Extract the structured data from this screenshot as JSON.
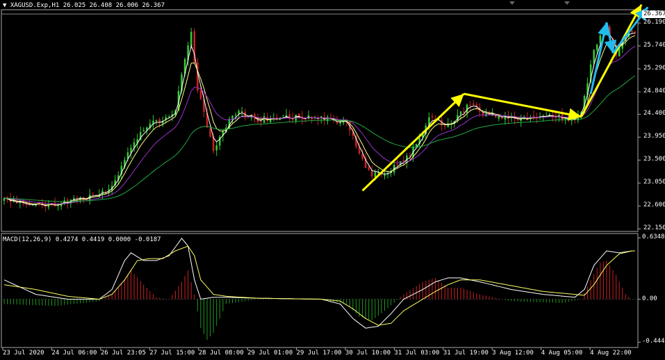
{
  "header": {
    "symbol_label": "XAGUSD.Exp,H1",
    "ohlc": "26.025 26.408 26.006 26.367",
    "macd_label": "MACD(12,26,9) 0.4274 0.4419 0.0000 -0.0187"
  },
  "colors": {
    "background": "#000000",
    "bull_candle": "#33cc33",
    "bear_candle": "#cc2222",
    "fast_ma": "#ffff88",
    "mid_ma": "#9932cc",
    "slow_ma": "#22aa44",
    "white_ma": "#ffffff",
    "annotation_yellow": "#ffff00",
    "annotation_cyan": "#22bbee",
    "hist_pos": "#cc2222",
    "hist_neg": "#229922",
    "macd_line": "#ffffff",
    "signal_line": "#ffff66",
    "axis": "#aaaaaa"
  },
  "chart_data": {
    "type": "candlestick",
    "price_axis": {
      "ticks": [
        "26.190",
        "25.740",
        "25.290",
        "24.840",
        "24.400",
        "23.950",
        "23.500",
        "23.050",
        "22.600",
        "22.150"
      ],
      "range": [
        22.1,
        26.45
      ],
      "current_price": "26.367"
    },
    "time_axis": {
      "ticks": [
        "23 Jul 2020",
        "24 Jul 06:00",
        "26 Jul 23:05",
        "27 Jul 15:00",
        "28 Jul 08:00",
        "29 Jul 01:00",
        "29 Jul 17:00",
        "30 Jul 10:00",
        "31 Jul 03:00",
        "31 Jul 19:00",
        "3 Aug 12:00",
        "4 Aug 05:00",
        "4 Aug 22:00"
      ]
    },
    "key_closes": [
      [
        0,
        22.72
      ],
      [
        14,
        22.62
      ],
      [
        24,
        22.72
      ],
      [
        34,
        22.95
      ],
      [
        40,
        23.8
      ],
      [
        46,
        24.25
      ],
      [
        50,
        24.25
      ],
      [
        54,
        24.5
      ],
      [
        57,
        25.5
      ],
      [
        59,
        26.0
      ],
      [
        61,
        24.9
      ],
      [
        63,
        24.4
      ],
      [
        66,
        23.7
      ],
      [
        68,
        23.95
      ],
      [
        71,
        24.3
      ],
      [
        74,
        24.45
      ],
      [
        80,
        24.3
      ],
      [
        90,
        24.35
      ],
      [
        100,
        24.3
      ],
      [
        108,
        24.25
      ],
      [
        112,
        23.6
      ],
      [
        116,
        23.2
      ],
      [
        120,
        23.25
      ],
      [
        124,
        23.4
      ],
      [
        128,
        23.6
      ],
      [
        134,
        24.3
      ],
      [
        140,
        24.2
      ],
      [
        144,
        24.4
      ],
      [
        147,
        24.6
      ],
      [
        150,
        24.45
      ],
      [
        160,
        24.3
      ],
      [
        170,
        24.35
      ],
      [
        180,
        24.3
      ],
      [
        182,
        24.4
      ],
      [
        185,
        25.4
      ],
      [
        188,
        26.0
      ],
      [
        190,
        26.1
      ],
      [
        193,
        25.6
      ],
      [
        196,
        26.0
      ],
      [
        198,
        26.05
      ]
    ],
    "macd": {
      "ticks": [
        "0.6348",
        "0.00",
        "-0.4449"
      ],
      "range": [
        -0.5,
        0.68
      ],
      "key_hist": [
        [
          0,
          -0.05
        ],
        [
          16,
          -0.07
        ],
        [
          30,
          -0.02
        ],
        [
          34,
          0.05
        ],
        [
          38,
          0.2
        ],
        [
          40,
          0.3
        ],
        [
          44,
          0.15
        ],
        [
          48,
          0.02
        ],
        [
          52,
          0.0
        ],
        [
          56,
          0.18
        ],
        [
          58,
          0.3
        ],
        [
          60,
          0.05
        ],
        [
          62,
          -0.3
        ],
        [
          64,
          -0.42
        ],
        [
          66,
          -0.35
        ],
        [
          70,
          -0.05
        ],
        [
          80,
          0.0
        ],
        [
          100,
          0.0
        ],
        [
          108,
          -0.05
        ],
        [
          112,
          -0.18
        ],
        [
          116,
          -0.22
        ],
        [
          120,
          -0.12
        ],
        [
          126,
          0.05
        ],
        [
          132,
          0.18
        ],
        [
          136,
          0.22
        ],
        [
          140,
          0.12
        ],
        [
          144,
          0.12
        ],
        [
          150,
          0.05
        ],
        [
          160,
          -0.02
        ],
        [
          176,
          -0.04
        ],
        [
          182,
          0.0
        ],
        [
          185,
          0.2
        ],
        [
          188,
          0.38
        ],
        [
          190,
          0.4
        ],
        [
          193,
          0.25
        ],
        [
          196,
          0.05
        ],
        [
          198,
          0.0
        ]
      ],
      "key_macd": [
        [
          0,
          0.2
        ],
        [
          10,
          0.05
        ],
        [
          20,
          0.0
        ],
        [
          30,
          0.0
        ],
        [
          34,
          0.1
        ],
        [
          38,
          0.4
        ],
        [
          40,
          0.48
        ],
        [
          44,
          0.4
        ],
        [
          48,
          0.4
        ],
        [
          52,
          0.45
        ],
        [
          56,
          0.63
        ],
        [
          58,
          0.55
        ],
        [
          60,
          0.2
        ],
        [
          62,
          0.0
        ],
        [
          66,
          0.02
        ],
        [
          70,
          0.02
        ],
        [
          80,
          0.01
        ],
        [
          100,
          0.0
        ],
        [
          106,
          -0.05
        ],
        [
          110,
          -0.2
        ],
        [
          114,
          -0.3
        ],
        [
          118,
          -0.28
        ],
        [
          122,
          -0.15
        ],
        [
          126,
          0.0
        ],
        [
          132,
          0.1
        ],
        [
          136,
          0.18
        ],
        [
          140,
          0.22
        ],
        [
          144,
          0.22
        ],
        [
          150,
          0.18
        ],
        [
          160,
          0.1
        ],
        [
          170,
          0.05
        ],
        [
          180,
          0.02
        ],
        [
          183,
          0.1
        ],
        [
          186,
          0.35
        ],
        [
          190,
          0.5
        ],
        [
          194,
          0.48
        ],
        [
          198,
          0.5
        ]
      ],
      "key_signal": [
        [
          0,
          0.15
        ],
        [
          10,
          0.1
        ],
        [
          20,
          0.03
        ],
        [
          30,
          0.0
        ],
        [
          34,
          0.05
        ],
        [
          38,
          0.2
        ],
        [
          42,
          0.4
        ],
        [
          46,
          0.42
        ],
        [
          50,
          0.42
        ],
        [
          54,
          0.5
        ],
        [
          58,
          0.55
        ],
        [
          60,
          0.45
        ],
        [
          62,
          0.2
        ],
        [
          66,
          0.05
        ],
        [
          70,
          0.03
        ],
        [
          80,
          0.01
        ],
        [
          100,
          0.0
        ],
        [
          106,
          -0.02
        ],
        [
          110,
          -0.1
        ],
        [
          114,
          -0.2
        ],
        [
          118,
          -0.27
        ],
        [
          122,
          -0.25
        ],
        [
          126,
          -0.12
        ],
        [
          132,
          0.0
        ],
        [
          136,
          0.08
        ],
        [
          140,
          0.15
        ],
        [
          144,
          0.2
        ],
        [
          150,
          0.2
        ],
        [
          160,
          0.14
        ],
        [
          170,
          0.08
        ],
        [
          180,
          0.05
        ],
        [
          183,
          0.04
        ],
        [
          186,
          0.15
        ],
        [
          190,
          0.35
        ],
        [
          194,
          0.47
        ],
        [
          198,
          0.5
        ]
      ]
    },
    "annotations": [
      {
        "color": "yellow",
        "from": [
          113,
          22.9
        ],
        "to": [
          145,
          24.8
        ]
      },
      {
        "color": "yellow",
        "from": [
          145,
          24.8
        ],
        "to": [
          182,
          24.35
        ]
      },
      {
        "color": "yellow",
        "from": [
          182,
          24.35
        ],
        "to": [
          201,
          26.55
        ]
      },
      {
        "color": "cyan",
        "from": [
          185,
          24.8
        ],
        "to": [
          190,
          26.2
        ]
      },
      {
        "color": "cyan",
        "from": [
          190,
          26.2
        ],
        "to": [
          192,
          25.6
        ]
      },
      {
        "color": "cyan",
        "from": [
          192,
          25.6
        ],
        "to": [
          203,
          26.5
        ]
      }
    ]
  }
}
